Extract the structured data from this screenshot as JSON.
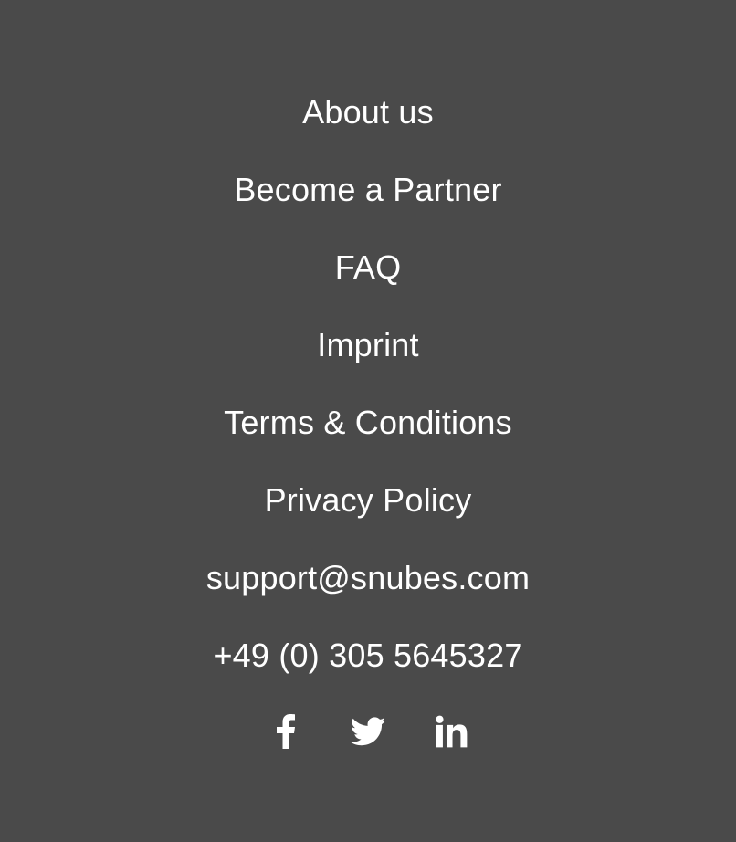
{
  "footer": {
    "links": [
      {
        "label": "About us"
      },
      {
        "label": "Become a Partner"
      },
      {
        "label": "FAQ"
      },
      {
        "label": "Imprint"
      },
      {
        "label": "Terms & Conditions"
      },
      {
        "label": "Privacy Policy"
      }
    ],
    "contact": {
      "email": "support@snubes.com",
      "phone": "+49 (0) 305 5645327"
    },
    "social": [
      {
        "icon": "facebook-icon"
      },
      {
        "icon": "twitter-icon"
      },
      {
        "icon": "linkedin-icon"
      }
    ]
  },
  "colors": {
    "background": "#4a4a4a",
    "text": "#ffffff"
  }
}
